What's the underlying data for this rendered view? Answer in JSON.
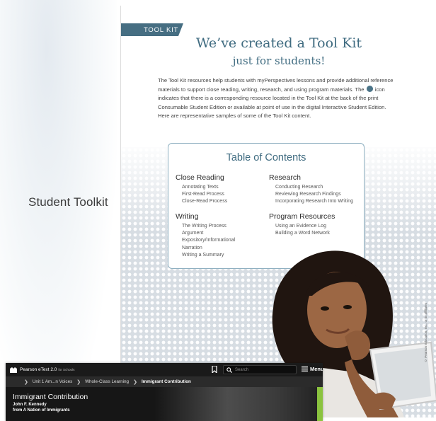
{
  "side_label": "Student Toolkit",
  "page": {
    "tab_label": "TOOL KIT",
    "title_line1": "We’ve created a Tool Kit",
    "title_line2": "just for students!",
    "intro_before_icon": "The Tool Kit resources help students with myPerspectives lessons and provide additional reference materials to support close reading, writing, research, and using program materials. The",
    "intro_after_icon": "icon indicates that there is a corresponding resource located in the Tool Kit at the back of the print Consumable Student Edition or available at point of use in the digital Interactive Student Edition. Here are representative samples of some of the Tool Kit content.",
    "vertical_caption": "© Pearson Education, Inc., or its affiliates"
  },
  "toc": {
    "title": "Table of Contents",
    "sections": [
      {
        "heading": "Close Reading",
        "items": [
          "Annotating Texts",
          "First-Read Process",
          "Close-Read Process"
        ]
      },
      {
        "heading": "Writing",
        "items": [
          "The Writing Process",
          "Argument",
          "Expository/Informational",
          "Narration",
          "Writing a Summary"
        ]
      },
      {
        "heading": "Research",
        "items": [
          "Conducting Research",
          "Reviewing Research Findings",
          "Incorporating Research Into Writing"
        ]
      },
      {
        "heading": "Program Resources",
        "items": [
          "Using an Evidence Log",
          "Building a Word Network"
        ]
      }
    ]
  },
  "etext": {
    "brand": "Pearson eText 2.0",
    "brand_sub": "for Schools",
    "search_placeholder": "Search",
    "menu_label": "Menu",
    "breadcrumbs": [
      "Unit 1 Am...n Voices",
      "Whole-Class Learning",
      "Immigrant Contribution"
    ],
    "heading": "Immigrant Contribution",
    "author": "John F. Kennedy",
    "source": "from A Nation of Immigrants"
  },
  "colors": {
    "accent_teal": "#466e82",
    "title_blue": "#3f6b80",
    "green_bar": "#8bc33f"
  }
}
